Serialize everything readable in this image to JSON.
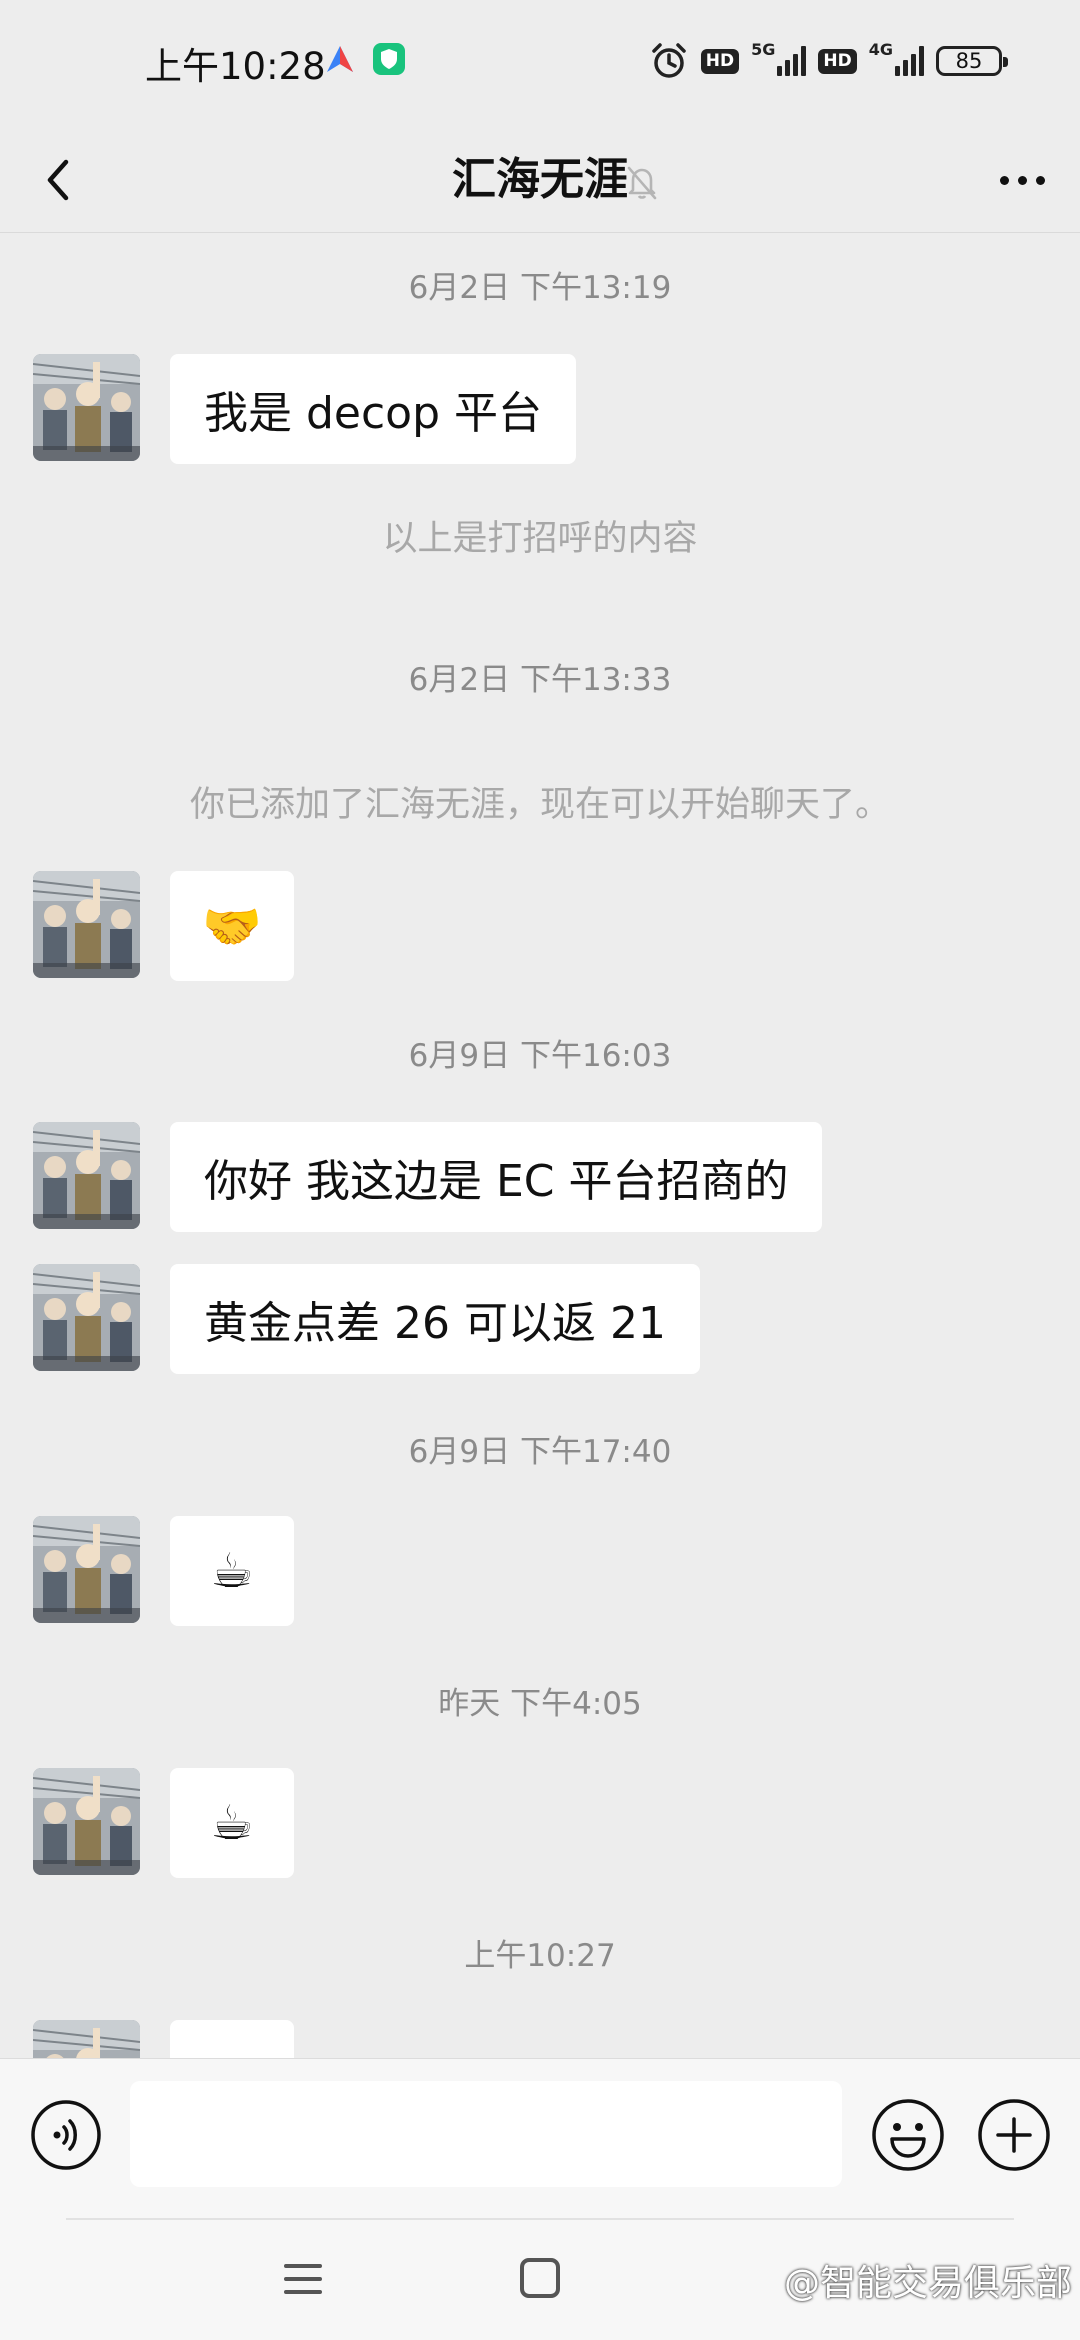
{
  "status_bar": {
    "time": "上午10:28",
    "network_1": "5G",
    "network_2": "4G",
    "hd_label": "HD",
    "battery": "85"
  },
  "header": {
    "title": "汇海无涯"
  },
  "messages": {
    "t1": "6月2日 下午13:19",
    "m1": "我是 decop 平台",
    "note1": "以上是打招呼的内容",
    "t2": "6月2日 下午13:33",
    "note2": "你已添加了汇海无涯，现在可以开始聊天了。",
    "m2": "🤝",
    "t3": "6月9日 下午16:03",
    "m3": "你好 我这边是 EC 平台招商的",
    "m4": "黄金点差 26 可以返 21",
    "t4": "6月9日 下午17:40",
    "m5": "☕",
    "t5": "昨天 下午4:05",
    "m6": "☕",
    "t6": "上午10:27"
  },
  "watermark": "@智能交易俱乐部",
  "colors": {
    "background": "#ededed",
    "bubble": "#ffffff",
    "timestamp": "#8a8a8a",
    "system_note": "#a8a8a8"
  },
  "icons": [
    "back-arrow-icon",
    "mute-bell-icon",
    "more-dots-icon",
    "voice-icon",
    "emoji-face-icon",
    "plus-icon",
    "menu-icon",
    "home-icon",
    "alarm-icon",
    "signal-icon",
    "battery-icon"
  ]
}
